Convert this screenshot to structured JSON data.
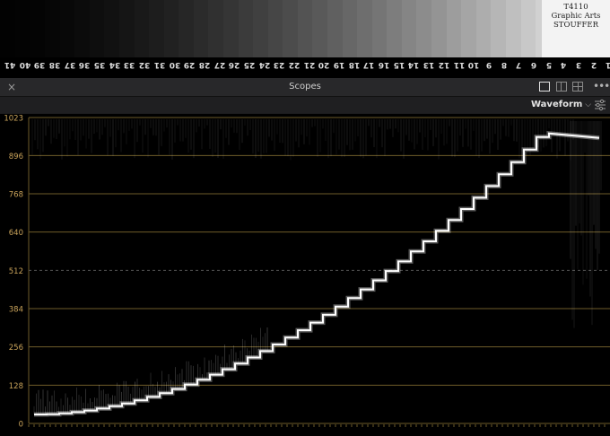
{
  "stepwedge": {
    "label_lines": [
      "STOUFFER",
      "Graphic Arts",
      "T4110"
    ],
    "steps": [
      "41",
      "40",
      "39",
      "38",
      "37",
      "36",
      "35",
      "34",
      "33",
      "32",
      "31",
      "30",
      "29",
      "28",
      "27",
      "26",
      "25",
      "24",
      "23",
      "22",
      "21",
      "20",
      "19",
      "18",
      "17",
      "16",
      "15",
      "14",
      "13",
      "12",
      "11",
      "10",
      "9",
      "8",
      "7",
      "6",
      "5",
      "4",
      "3",
      "2",
      "1"
    ]
  },
  "panel": {
    "title": "Scopes",
    "close_glyph": "×",
    "more_glyph": "•••",
    "scope_type": "Waveform",
    "layout_options": [
      "single",
      "double",
      "quad"
    ]
  },
  "waveform": {
    "scale_labels": [
      "1023",
      "896",
      "768",
      "640",
      "512",
      "384",
      "256",
      "128",
      "0"
    ],
    "scale_values": [
      1023,
      896,
      768,
      640,
      512,
      384,
      256,
      128,
      0
    ],
    "grid_color": "#6e5c2a",
    "label_color": "#c9a35a",
    "trace_color": "#ffffff"
  },
  "colors": {
    "panel_bg": "#1b1b1d",
    "titlebar_bg": "#28282a"
  }
}
